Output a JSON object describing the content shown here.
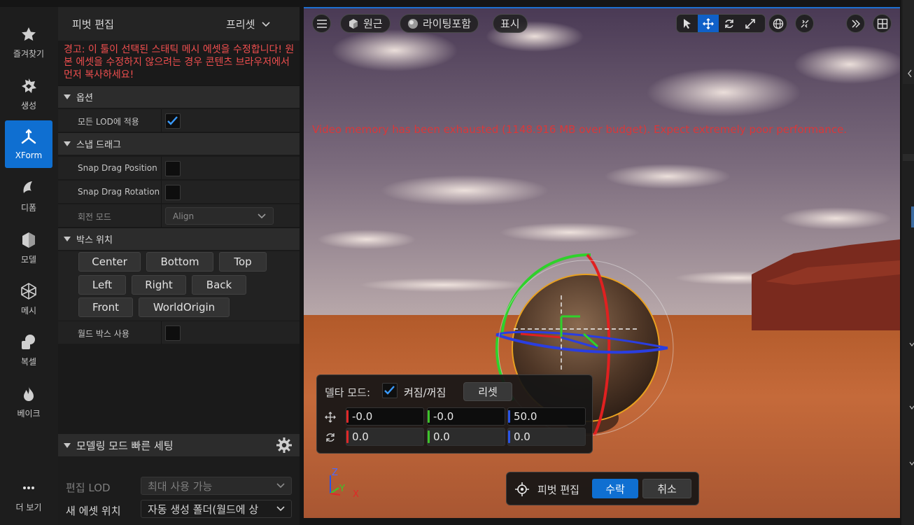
{
  "rail": {
    "items": [
      {
        "label": "즐겨찾기",
        "icon": "star-icon"
      },
      {
        "label": "생성",
        "icon": "create-icon"
      },
      {
        "label": "XForm",
        "icon": "xform-icon"
      },
      {
        "label": "디폼",
        "icon": "deform-icon"
      },
      {
        "label": "모델",
        "icon": "model-icon"
      },
      {
        "label": "메시",
        "icon": "mesh-icon"
      },
      {
        "label": "복셀",
        "icon": "voxel-icon"
      },
      {
        "label": "베이크",
        "icon": "bake-icon"
      }
    ],
    "more_label": "더 보기"
  },
  "panel": {
    "title": "피벗 편집",
    "preset_label": "프리셋",
    "warning": "경고: 이 툴이 선택된 스태틱 메시 에셋을 수정합니다! 원본 에셋을 수정하지 않으려는 경우 콘텐츠 브라우저에서 먼저 복사하세요!",
    "options_header": "옵션",
    "apply_all_lod_label": "모든 LOD에 적용",
    "apply_all_lod_checked": true,
    "snap_header": "스냅 드래그",
    "snap_drag_position_label": "Snap Drag Position",
    "snap_drag_rotation_label": "Snap Drag Rotation",
    "rotation_mode_label": "회전 모드",
    "rotation_mode_value": "Align",
    "box_header": "박스 위치",
    "box_buttons": [
      "Center",
      "Bottom",
      "Top",
      "Left",
      "Right",
      "Back",
      "Front",
      "WorldOrigin"
    ],
    "world_box_label": "월드 박스 사용",
    "quick": {
      "header": "모델링 모드 빠른 세팅",
      "edit_lod_label": "편집 LOD",
      "edit_lod_value": "최대 사용 가능",
      "new_asset_label": "새 에셋 위치",
      "new_asset_value": "자동 생성 폴더(월드에 상"
    }
  },
  "viewport": {
    "perspective_label": "원근",
    "lighting_label": "라이팅포함",
    "show_label": "표시",
    "warning": "Video memory has been exhausted (1148.916 MB over budget). Expect extremely poor performance.",
    "axis": {
      "z": "Z",
      "y": "Y",
      "x": "X"
    },
    "delta": {
      "mode_label": "델타 모드:",
      "mode_checked": true,
      "onoff_label": "켜짐/꺼짐",
      "reset_label": "리셋",
      "translate": [
        "-0.0",
        "-0.0",
        "50.0"
      ],
      "rotate": [
        "0.0",
        "0.0",
        "0.0"
      ]
    },
    "pivot": {
      "label": "피벗 편집",
      "accept_label": "수락",
      "cancel_label": "취소"
    }
  },
  "colors": {
    "accent": "#0f6fd1",
    "warning": "#ee4e4e",
    "axis_x": "#e02828",
    "axis_y": "#3ec42b",
    "axis_z": "#2a54e6"
  }
}
